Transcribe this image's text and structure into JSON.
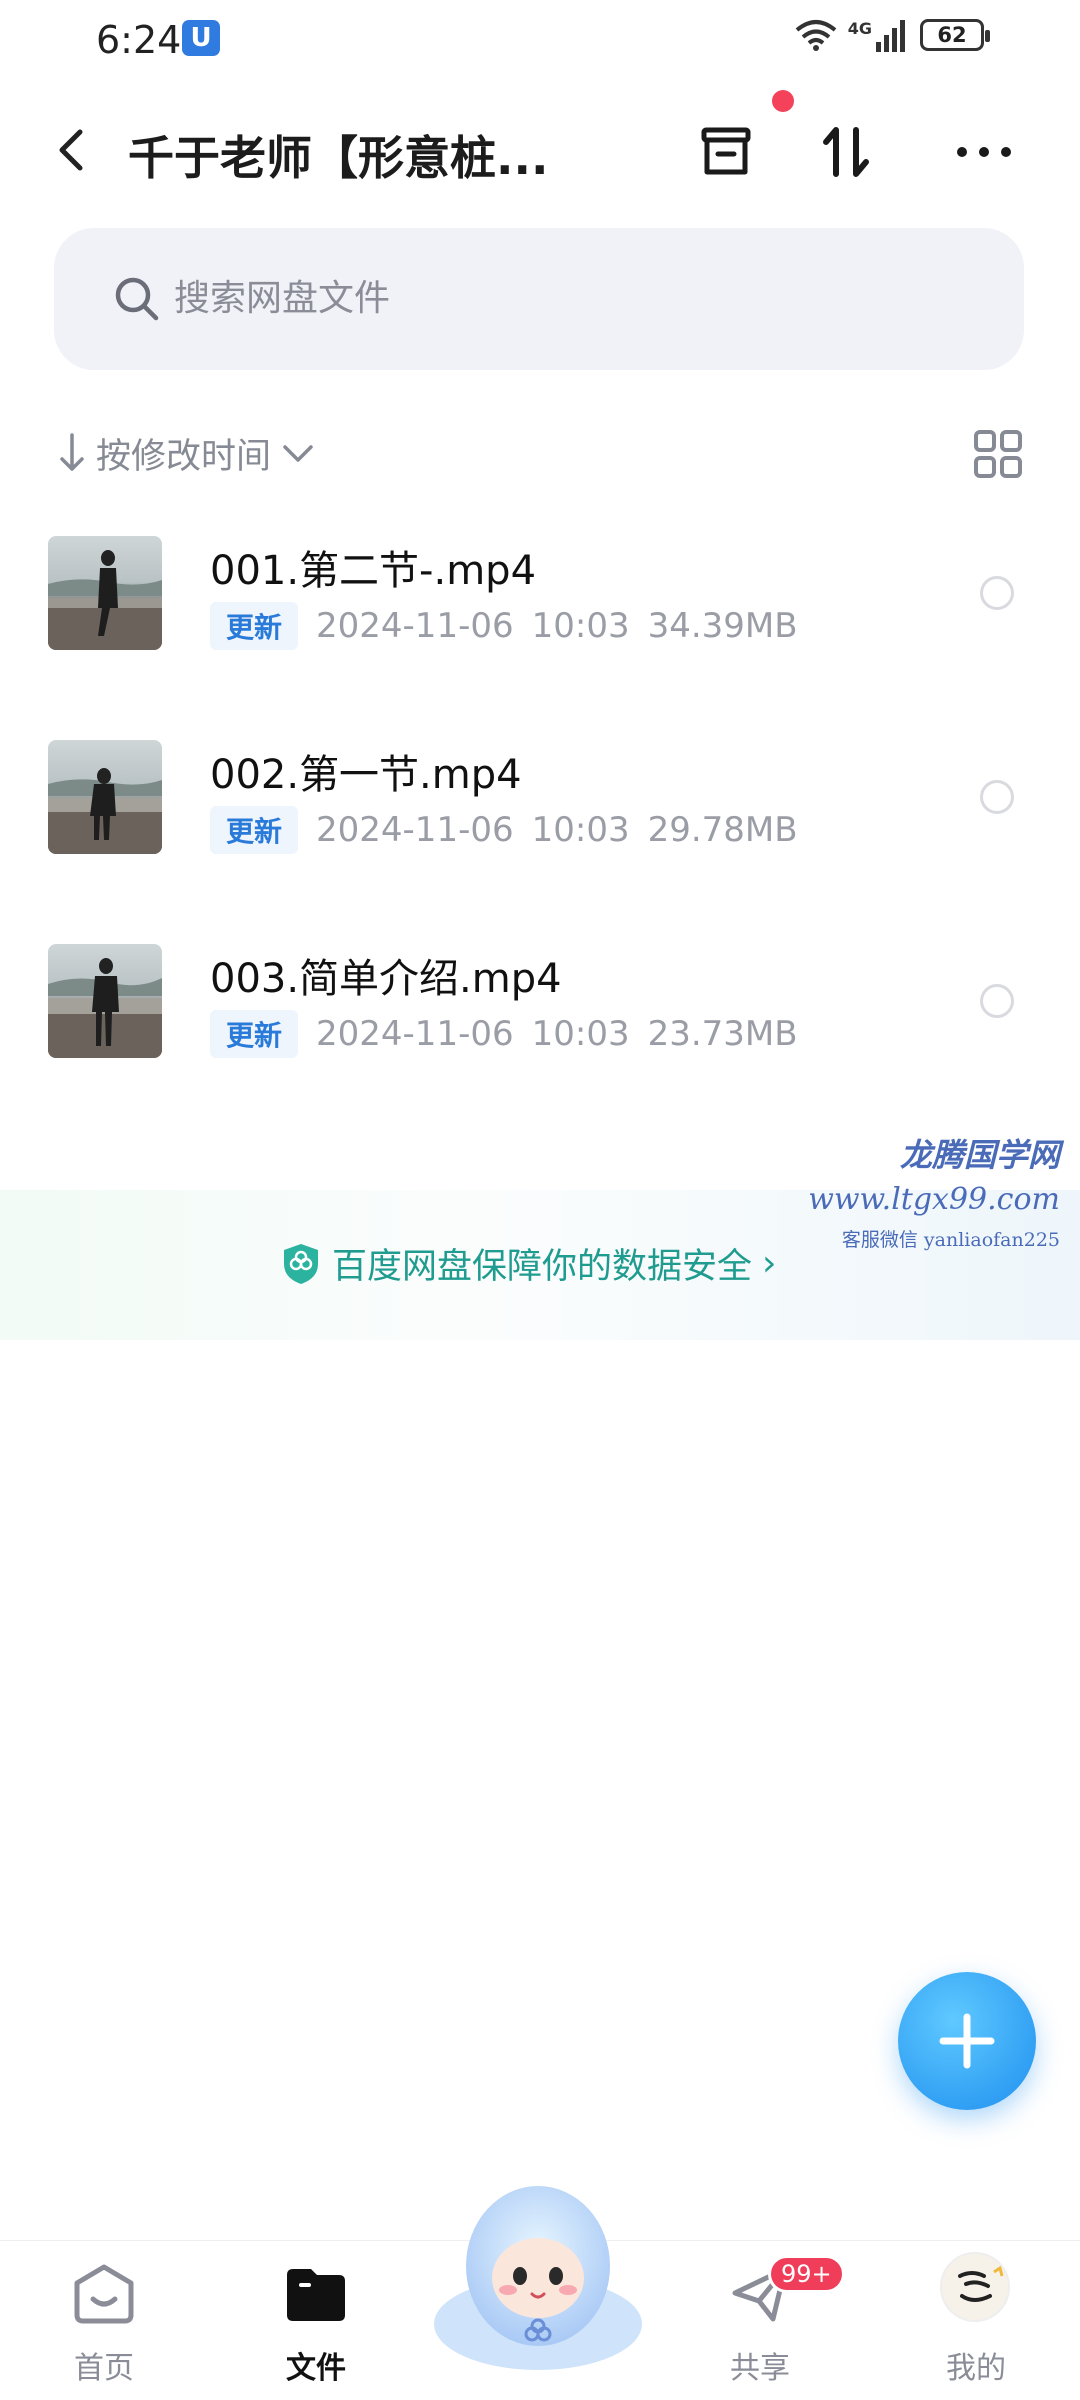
{
  "status_bar": {
    "time": "6:24",
    "app_badge": "U",
    "network": "4G",
    "battery": "62"
  },
  "header": {
    "title": "千于老师【形意桩..."
  },
  "search": {
    "placeholder": "搜索网盘文件"
  },
  "sort": {
    "label": "按修改时间"
  },
  "files": [
    {
      "name": "001.第二节-.mp4",
      "tag": "更新",
      "date": "2024-11-06",
      "time": "10:03",
      "size": "34.39MB"
    },
    {
      "name": "002.第一节.mp4",
      "tag": "更新",
      "date": "2024-11-06",
      "time": "10:03",
      "size": "29.78MB"
    },
    {
      "name": "003.简单介绍.mp4",
      "tag": "更新",
      "date": "2024-11-06",
      "time": "10:03",
      "size": "23.73MB"
    }
  ],
  "watermark": {
    "line1": "龙腾国学网",
    "line2": "www.ltgx99.com",
    "line3": "客服微信 yanliaofan225"
  },
  "security_banner": {
    "text": "百度网盘保障你的数据安全"
  },
  "bottom_nav": {
    "home": "首页",
    "files": "文件",
    "share": "共享",
    "share_badge": "99+",
    "mine": "我的"
  },
  "colors": {
    "accent": "#1f8fef",
    "tag_blue": "#2a7bd9",
    "security_green": "#1f9c8f",
    "badge_red": "#f03e5a"
  }
}
